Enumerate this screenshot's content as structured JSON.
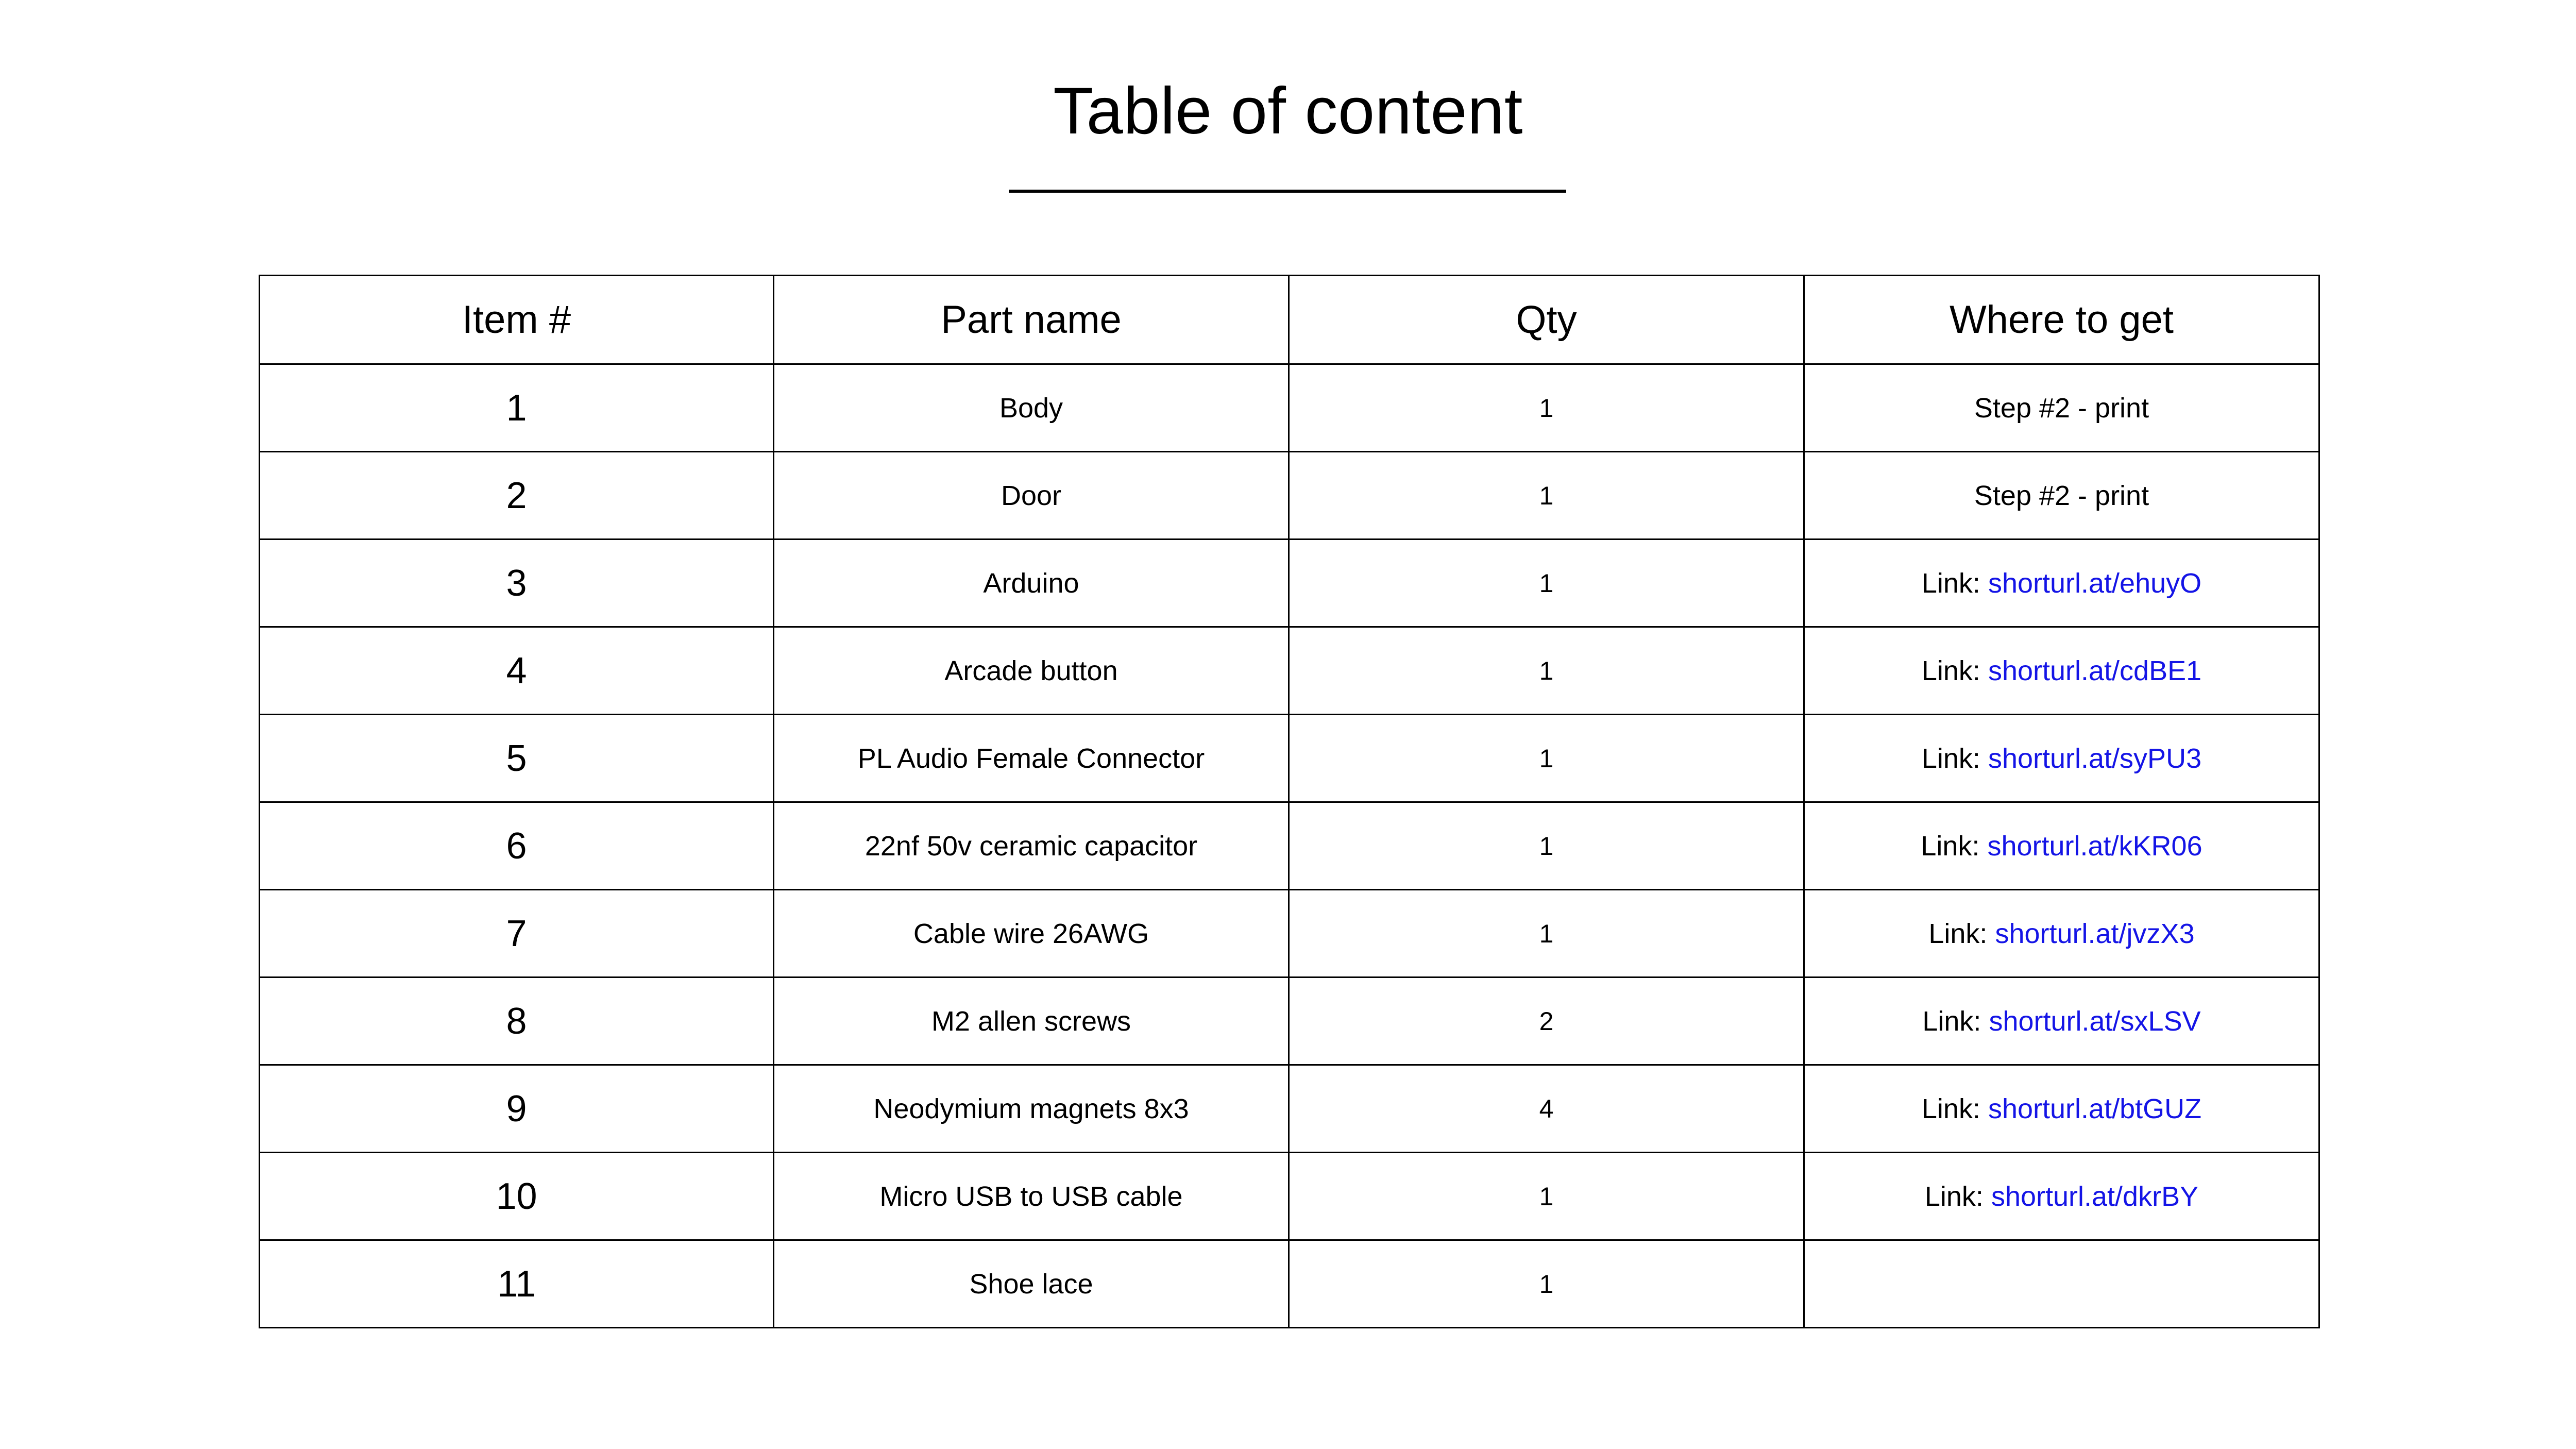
{
  "page": {
    "title": "Table of content",
    "background_color": "#FFFFFF",
    "text_color": "#000000",
    "link_color": "#1414E6"
  },
  "table": {
    "columns": [
      "Item #",
      "Part name",
      "Qty",
      "Where to get"
    ],
    "link_prefix": "Link: ",
    "rows": [
      {
        "item": "1",
        "part": "Body",
        "qty": "1",
        "where": "Step #2 - print",
        "where_is_link": false,
        "url": ""
      },
      {
        "item": "2",
        "part": "Door",
        "qty": "1",
        "where": "Step #2 - print",
        "where_is_link": false,
        "url": ""
      },
      {
        "item": "3",
        "part": "Arduino",
        "qty": "1",
        "where": "",
        "where_is_link": true,
        "url": "shorturl.at/ehuyO"
      },
      {
        "item": "4",
        "part": "Arcade button",
        "qty": "1",
        "where": "",
        "where_is_link": true,
        "url": "shorturl.at/cdBE1"
      },
      {
        "item": "5",
        "part": "PL Audio Female Connector",
        "qty": "1",
        "where": "",
        "where_is_link": true,
        "url": "shorturl.at/syPU3"
      },
      {
        "item": "6",
        "part": "22nf 50v ceramic capacitor",
        "qty": "1",
        "where": "",
        "where_is_link": true,
        "url": "shorturl.at/kKR06"
      },
      {
        "item": "7",
        "part": "Cable wire 26AWG",
        "qty": "1",
        "where": "",
        "where_is_link": true,
        "url": "shorturl.at/jvzX3"
      },
      {
        "item": "8",
        "part": "M2 allen screws",
        "qty": "2",
        "where": "",
        "where_is_link": true,
        "url": "shorturl.at/sxLSV"
      },
      {
        "item": "9",
        "part": "Neodymium magnets 8x3",
        "qty": "4",
        "where": "",
        "where_is_link": true,
        "url": "shorturl.at/btGUZ"
      },
      {
        "item": "10",
        "part": "Micro USB to USB cable",
        "qty": "1",
        "where": "",
        "where_is_link": true,
        "url": "shorturl.at/dkrBY"
      },
      {
        "item": "11",
        "part": "Shoe lace",
        "qty": "1",
        "where": "",
        "where_is_link": false,
        "url": ""
      }
    ]
  }
}
